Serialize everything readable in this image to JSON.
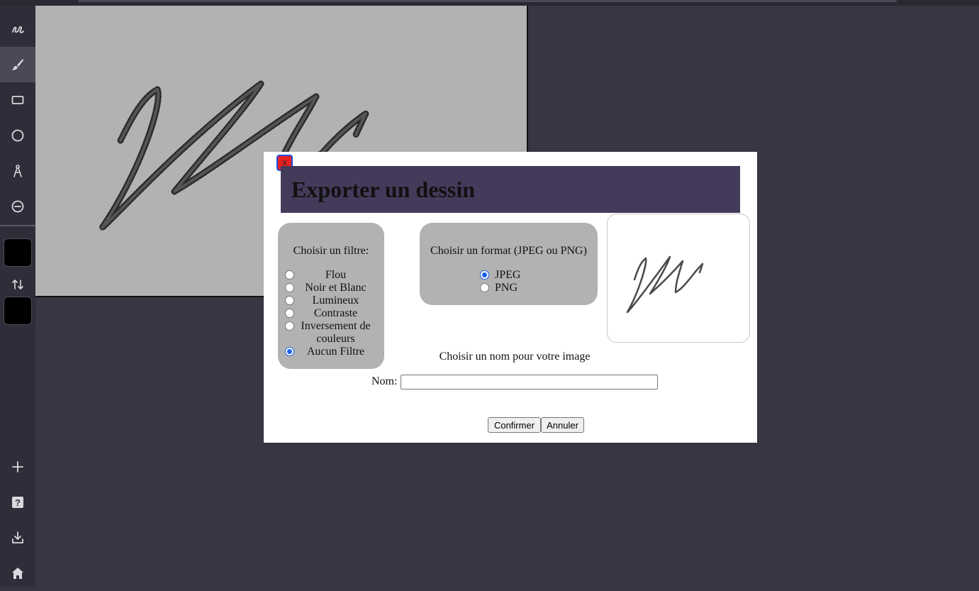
{
  "sidebar": {
    "tools": [
      {
        "icon": "freehand-squiggle-icon"
      },
      {
        "icon": "brush-icon",
        "active": true
      },
      {
        "icon": "rectangle-icon"
      },
      {
        "icon": "ellipse-icon"
      },
      {
        "icon": "compass-icon"
      },
      {
        "icon": "eraser-icon"
      }
    ],
    "primary_color": "#000000",
    "secondary_color": "#000000",
    "bottom_tools": [
      {
        "icon": "plus-icon"
      },
      {
        "icon": "help-icon"
      },
      {
        "icon": "download-icon"
      },
      {
        "icon": "home-icon"
      }
    ]
  },
  "colors": {
    "background": "#373642",
    "sidebar": "#2e2d39",
    "canvas": "#b2b2b2",
    "modal_header": "#443a5a",
    "close_button": "#e8211e",
    "radio_accent": "#1a62e8"
  },
  "modal": {
    "close_label": "X",
    "title": "Exporter un dessin",
    "filters": {
      "title": "Choisir un filtre:",
      "options": [
        {
          "label": "Flou",
          "checked": false
        },
        {
          "label": "Noir et Blanc",
          "checked": false
        },
        {
          "label": "Lumineux",
          "checked": false
        },
        {
          "label": "Contraste",
          "checked": false
        },
        {
          "label": "Inversement de couleurs",
          "checked": false
        },
        {
          "label": "Aucun Filtre",
          "checked": true
        }
      ]
    },
    "format": {
      "title": "Choisir un format (JPEG ou PNG)",
      "options": [
        {
          "label": "JPEG",
          "checked": true
        },
        {
          "label": "PNG",
          "checked": false
        }
      ]
    },
    "name_prompt": "Choisir un nom pour votre image",
    "name_label": "Nom:",
    "name_value": "",
    "confirm_label": "Confirmer",
    "cancel_label": "Annuler"
  }
}
